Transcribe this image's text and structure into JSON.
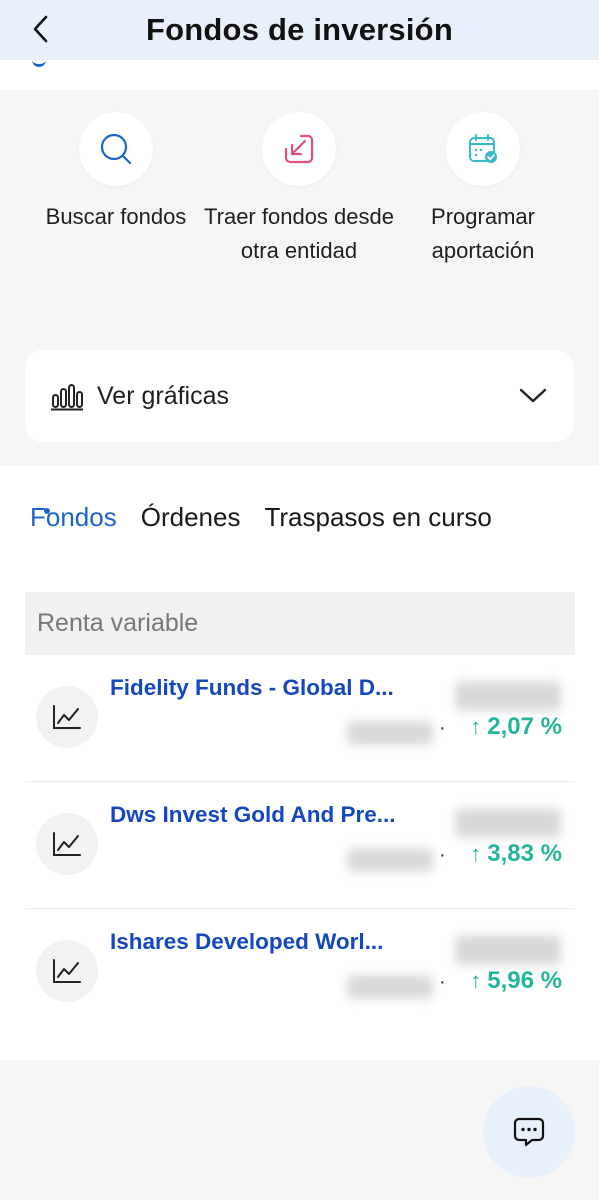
{
  "header": {
    "title": "Fondos de inversión"
  },
  "actions": [
    {
      "label": "Buscar fondos",
      "icon": "search-icon"
    },
    {
      "label": "Traer fondos desde otra entidad",
      "icon": "import-arrow-icon"
    },
    {
      "label": "Programar aportación",
      "icon": "calendar-check-icon"
    }
  ],
  "charts": {
    "label": "Ver gráficas"
  },
  "tabs": [
    {
      "label": "Fondos",
      "active": true
    },
    {
      "label": "Órdenes",
      "active": false
    },
    {
      "label": "Traspasos en curso",
      "active": false
    }
  ],
  "section": {
    "title": "Renta variable"
  },
  "funds": [
    {
      "name": "Fidelity Funds - Global D...",
      "change": "2,07 %"
    },
    {
      "name": "Dws Invest Gold And Pre...",
      "change": "3,83 %"
    },
    {
      "name": "Ishares Developed Worl...",
      "change": "5,96 %"
    }
  ],
  "colors": {
    "accent": "#1d64c8",
    "fund_name": "#1548c0",
    "positive": "#24b59b",
    "header_bg": "#e8f1fb"
  }
}
